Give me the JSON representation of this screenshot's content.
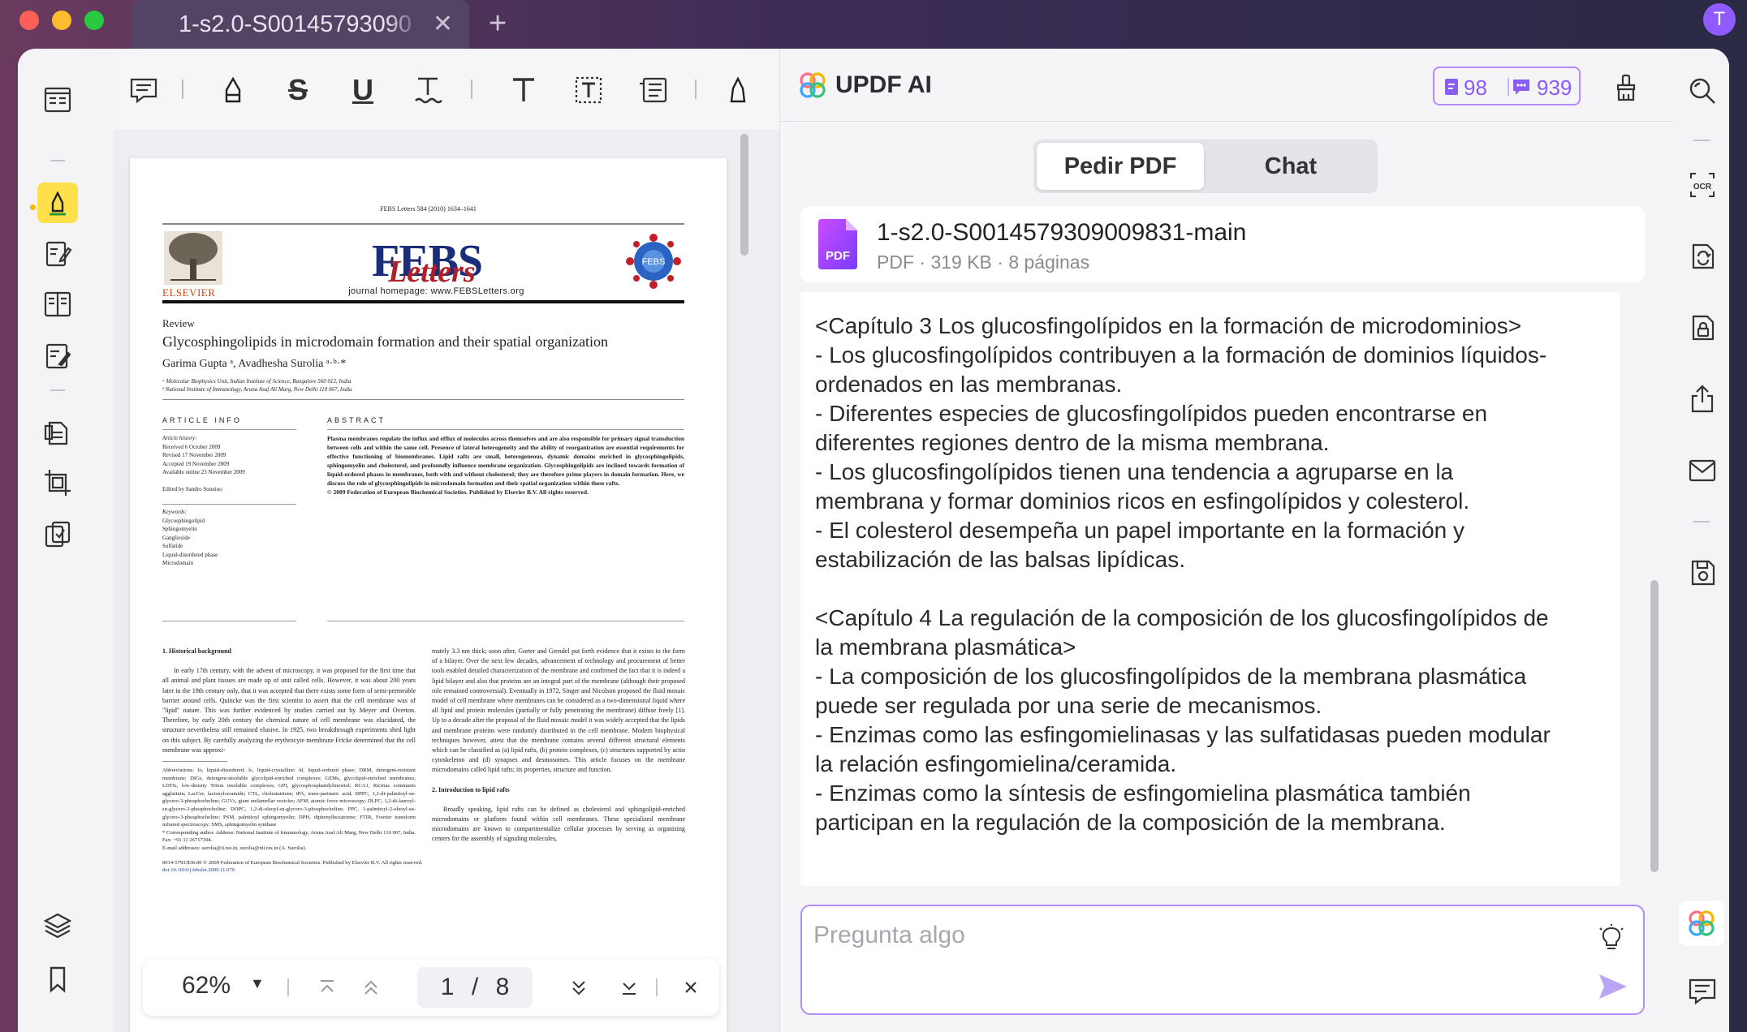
{
  "window": {
    "tab_title": "1-s2.0-S00145793090",
    "avatar_initial": "T"
  },
  "pdf": {
    "journal_header": "FEBS Letters 584 (2010) 1634–1641",
    "publisher": "ELSEVIER",
    "journal_logo_main": "FEBS",
    "journal_logo_script": "Letters",
    "journal_homepage": "journal homepage: www.FEBSLetters.org",
    "seal_text": "FEBS",
    "review_label": "Review",
    "title": "Glycosphingolipids in microdomain formation and their spatial organization",
    "authors": "Garima Gupta ᵃ, Avadhesha Surolia ᵃ·ᵇ·*",
    "affiliation_a": "ᵃ Molecular Biophysics Unit, Indian Institute of Science, Bangalore 560 012, India",
    "affiliation_b": "ᵇ National Institute of Immunology, Aruna Asaf Ali Marg, New Delhi 110 067, India",
    "article_info_head": "ARTICLE INFO",
    "abstract_head": "ABSTRACT",
    "article_history": "Article history:",
    "received": "Received 6 October 2009",
    "revised": "Revised 17 November 2009",
    "accepted": "Accepted 19 November 2009",
    "online": "Available online 23 November 2009",
    "edited_by": "Edited by Sandro Sonnino",
    "keywords_head": "Keywords:",
    "kw1": "Glycosphingolipid",
    "kw2": "Sphingomyelin",
    "kw3": "Ganglioside",
    "kw4": "Sulfatide",
    "kw5": "Liquid-disordered phase",
    "kw6": "Microdomain",
    "abstract": "Plasma membranes regulate the influx and efflux of molecules across themselves and are also responsible for primary signal transduction between cells and within the same cell. Presence of lateral heterogeneity and the ability of reorganization are essential requirements for effective functioning of biomembranes. Lipid rafts are small, heterogeneous, dynamic domains enriched in glycosphingolipids, sphingomyelin and cholesterol, and profoundly influence membrane organization. Glycosphingolipids are inclined towards formation of liquid-ordered phases in membranes, both with and without cholesterol; they are therefore prime players in domain formation. Here, we discuss the role of glycosphingolipids in microdomain formation and their spatial organization within these rafts.",
    "copyright_line": "© 2009 Federation of European Biochemical Societies. Published by Elsevier B.V. All rights reserved.",
    "sec1_head": "1. Historical background",
    "sec1_text": "In early 17th century, with the advent of microscopy, it was proposed for the first time that all animal and plant tissues are made up of unit called cells. However, it was about 200 years later in the 19th century only, that it was accepted that there exists some form of semi-permeable barrier around cells. Quincke was the first scientist to assert that the cell membrane was of \"lipid\" nature. This was further evidenced by studies carried out by Meyer and Overton. Therefore, by early 20th century the chemical nature of cell membrane was elucidated, the structure nevertheless still remained elusive. In 1925, two breakthrough experiments shed light on this subject. By carefully analyzing the erythrocyte membrane Fricke determined that the cell membrane was approxi-",
    "abbrev_text": "Abbreviations: lo, liquid-disordered; lc, liquid-crystalline; ld, liquid-ordered phase; DRM, detergent-resistant membrane; DIGs, detergent-insoluble glycolipid-enriched complexes; GEMs, glycolipid-enriched membranes; LDTIs, low-density Triton insoluble complexes; GPI, glycosphosphatidylinositol; RCA1, Ricinus communis agglutinin; LacCer, lactosylceramide; CTL, cholestatriene; tPA, trans-parinaric acid; DPPC, 1,2-di-palmitoyl-sn-glycero-3-phosphocholine; GUVs, giant unilamellar vesicles; AFM, atomic force microscopy; DLPC, 1,2-di-lauroyl-sn-glycero-3-phosphocholine; DOPC, 1,2-di-oleoyl-sn-glycero-3-phosphocholine; PPC, 1-palmitoyl-2-oleoyl-sn-glycero-3-phosphocholine; PSM, palmitoyl sphingomyelin; DPH, diphenylhexatriene; FTIR, Fourier transform infrared spectroscopy; SMS, sphingomyelin synthase",
    "corresp_text": "* Corresponding author. Address: National Institute of Immunology, Aruna Asaf Ali Marg, New Delhi 110 067, India. Fax: +91 11 26717104.",
    "email_text": "E-mail addresses: surolia@ii.res.in, surolia@nii.res.in (A. Surolia).",
    "issn_text": "0014-5793/$36.00 © 2009 Federation of European Biochemical Societies. Published by Elsevier B.V. All rights reserved.",
    "doi_text": "doi:10.1016/j.febslet.2009.11.070",
    "col2_text": "mately 3.3 nm thick; soon after, Gorter and Grendel put forth evidence that it exists in the form of a bilayer. Over the next few decades, advancement of technology and procurement of better tools enabled detailed characterization of the membrane and confirmed the fact that it is indeed a lipid bilayer and also that proteins are an integral part of the membrane (although their proposed role remained controversial). Eventually in 1972, Singer and Nicolson proposed the fluid mosaic model of cell membrane where membranes can be considered as a two-dimensional liquid where all lipid and protein molecules (partially or fully penetrating the membrane) diffuse freely [1]. Up to a decade after the proposal of the fluid mosaic model it was widely accepted that the lipids and membrane proteins were randomly distributed in the cell membrane. Modern biophysical techniques however, attest that the membrane contains several different structural elements which can be classified as (a) lipid rafts, (b) protein complexes, (c) structures supported by actin cytoskeleton and (d) synapses and desmosomes. This article focuses on the membrane microdomains called lipid rafts; its properties, structure and function.",
    "sec2_head": "2. Introduction to lipid rafts",
    "sec2_text": "Broadly speaking, lipid rafts can be defined as cholesterol and sphingolipid-enriched microdomains or platform found within cell membranes. These specialized membrane microdomains are known to compartmentalize cellular processes by serving as organizing centers for the assembly of signaling molecules,"
  },
  "page_nav": {
    "zoom": "62%",
    "current_page": "1",
    "slash": "/",
    "total_pages": "8"
  },
  "ai": {
    "title": "UPDF AI",
    "credits_docs": "98",
    "credits_chat": "939",
    "tab_pdf": "Pedir PDF",
    "tab_chat": "Chat",
    "file_icon_label": "PDF",
    "file_name": "1-s2.0-S0014579309009831-main",
    "file_meta": "PDF · 319 KB · 8 páginas",
    "answer_lines": [
      "<Capítulo 3 Los glucosfingolípidos en la formación de microdominios>",
      "- Los glucosfingolípidos contribuyen a la formación de dominios líquidos-",
      "ordenados en las membranas.",
      "- Diferentes especies de glucosfingolípidos pueden encontrarse en",
      "diferentes regiones dentro de la misma membrana.",
      "- Los glucosfingolípidos tienen una tendencia a agruparse en la",
      "membrana y formar dominios ricos en esfingolípidos y colesterol.",
      "- El colesterol desempeña un papel importante en la formación y",
      "estabilización de las balsas lipídicas.",
      "",
      "<Capítulo 4 La regulación de la composición de los glucosfingolípidos de",
      "la membrana plasmática>",
      "- La composición de los glucosfingolípidos de la membrana plasmática",
      "puede ser regulada por una serie de mecanismos.",
      "- Enzimas como las esfingomielinasas y las sulfatidasas pueden modular",
      "la relación esfingomielina/ceramida.",
      "- Enzimas como la síntesis de esfingomielina plasmática también",
      "participan en la regulación de la composición de la membrana."
    ],
    "input_placeholder": "Pregunta algo",
    "input_value": ""
  },
  "colors": {
    "accent_purple": "#8a5cf6",
    "highlight_yellow": "#fde04c",
    "close_red": "#ff5f57",
    "minimize_yellow": "#febc2e",
    "zoom_green": "#28c840"
  },
  "icons": {
    "left_rail": [
      "reader-icon",
      "highlighter-icon",
      "edit-pdf-icon",
      "organize-icon",
      "fill-sign-icon",
      "page-tools-icon",
      "crop-icon",
      "compare-icon",
      "layers-icon",
      "bookmark-icon"
    ],
    "toolbar": [
      "comment-icon",
      "highlighter-icon",
      "strikethrough-icon",
      "underline-icon",
      "squiggly-icon",
      "text-icon",
      "textbox-icon",
      "text-callout-icon",
      "pencil-icon"
    ],
    "right_rail": [
      "search-icon",
      "ocr-icon",
      "convert-icon",
      "protect-icon",
      "share-icon",
      "email-icon",
      "save-icon",
      "updf-ai-icon",
      "comments-icon"
    ]
  }
}
